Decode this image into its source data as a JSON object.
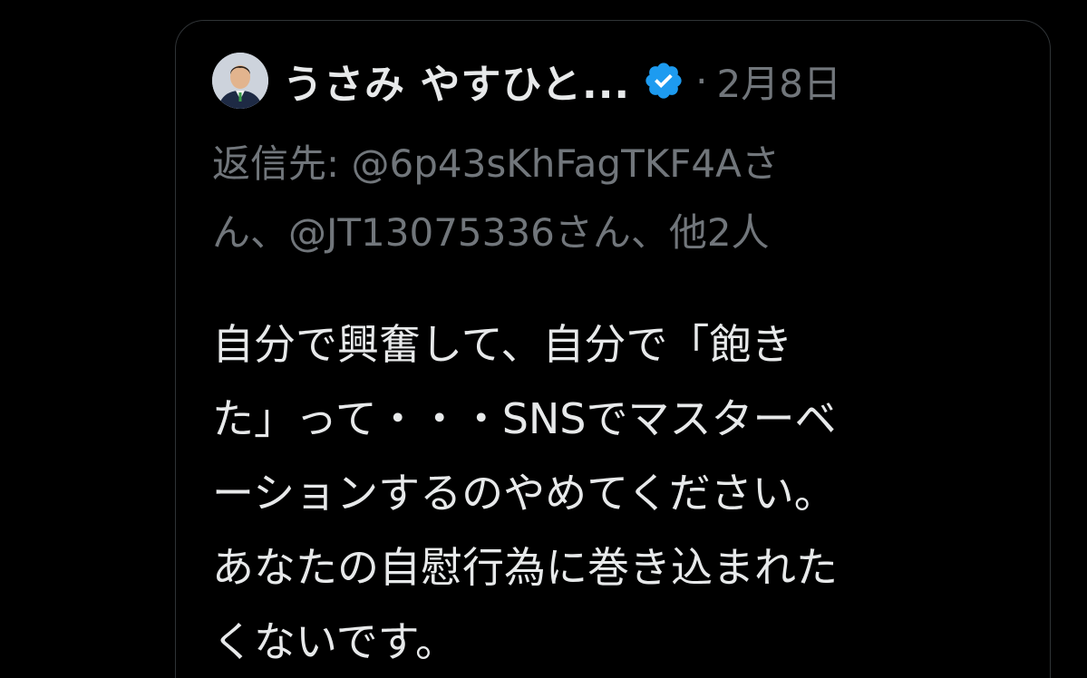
{
  "tweet": {
    "author": {
      "display_name": "うさみ やすひと...",
      "verified": true
    },
    "separator": "·",
    "timestamp": "2月8日",
    "reply_to": {
      "line1": "返信先: @6p43sKhFagTKF4Aさ",
      "line2": "ん、@JT13075336さん、他2人"
    },
    "text_lines": [
      "自分で興奮して、自分で「飽き",
      "た」って・・・SNSでマスターベ",
      "ーションするのやめてください。",
      "あなたの自慰行為に巻き込まれた",
      "くないです。"
    ]
  },
  "colors": {
    "background": "#000000",
    "primary_text": "#e7e9ea",
    "secondary_text": "#71767b",
    "verified_blue": "#1d9bf0",
    "card_border": "#2f3336"
  },
  "icons": {
    "avatar": "profile-photo",
    "verified": "verified-badge-icon"
  }
}
